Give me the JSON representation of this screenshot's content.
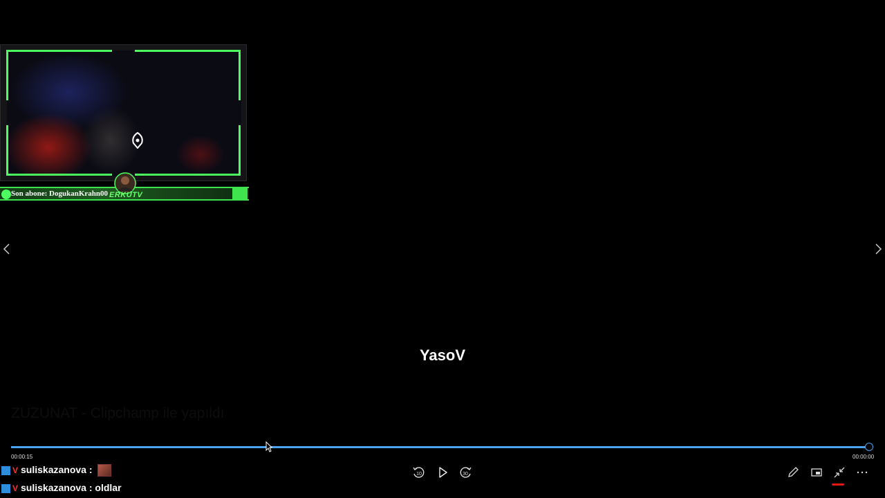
{
  "overlay": {
    "subscriber_text": "Son abone: DogukanKrahn00",
    "logo_text": "ERKUTV"
  },
  "video": {
    "title": "YasoV",
    "watermark": "ZUZUNAT - Clipchamp ile yapıldı",
    "current_time": "00:00:15",
    "end_time": "00:00:00",
    "progress": 1.0,
    "progress_color": "#4aa3f0"
  },
  "controls": {
    "rewind_label": "10",
    "forward_label": "30"
  },
  "chat": [
    {
      "user": "suliskazanova",
      "message": ""
    },
    {
      "user": "suliskazanova",
      "message": "oldlar"
    }
  ],
  "icons": {
    "prev": "chevron-left-icon",
    "next": "chevron-right-icon",
    "rewind": "rewind-10-icon",
    "play": "play-icon",
    "forward": "forward-30-icon",
    "edit": "pencil-icon",
    "miniplayer": "miniplayer-icon",
    "exit_fullscreen": "exit-fullscreen-icon",
    "more": "more-icon"
  }
}
